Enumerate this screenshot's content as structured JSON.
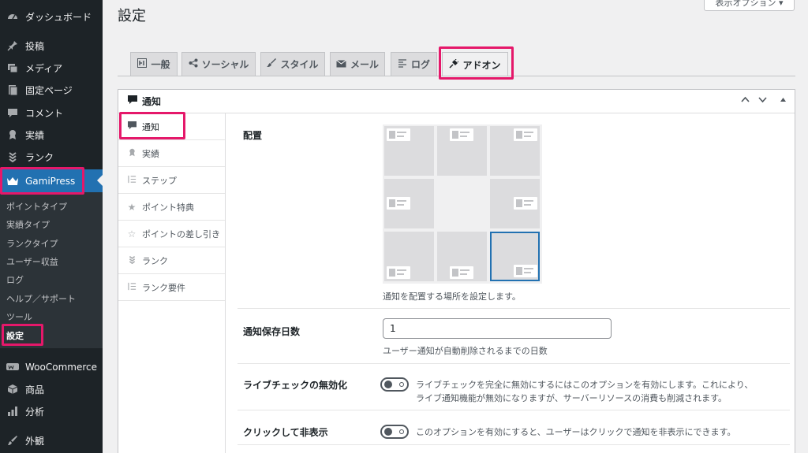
{
  "sidebar": {
    "items": [
      {
        "label": "ダッシュボード",
        "icon": "dashboard-icon"
      },
      {
        "label": "投稿",
        "icon": "pin-icon"
      },
      {
        "label": "メディア",
        "icon": "media-icon"
      },
      {
        "label": "固定ページ",
        "icon": "page-icon"
      },
      {
        "label": "コメント",
        "icon": "comment-icon"
      },
      {
        "label": "実績",
        "icon": "award-icon"
      },
      {
        "label": "ランク",
        "icon": "rank-icon"
      },
      {
        "label": "GamiPress",
        "icon": "crown-icon"
      },
      {
        "label": "WooCommerce",
        "icon": "woo-icon"
      },
      {
        "label": "商品",
        "icon": "box-icon"
      },
      {
        "label": "分析",
        "icon": "chart-icon"
      },
      {
        "label": "外観",
        "icon": "brush-icon"
      }
    ],
    "submenu": [
      "ポイントタイプ",
      "実績タイプ",
      "ランクタイプ",
      "ユーザー収益",
      "ログ",
      "ヘルプ／サポート",
      "ツール",
      "設定"
    ]
  },
  "header": {
    "title": "設定",
    "screen_options": "表示オプション ▾"
  },
  "tabs": [
    {
      "label": "一般",
      "icon": "general-icon"
    },
    {
      "label": "ソーシャル",
      "icon": "share-icon"
    },
    {
      "label": "スタイル",
      "icon": "brush-icon"
    },
    {
      "label": "メール",
      "icon": "mail-icon"
    },
    {
      "label": "ログ",
      "icon": "list-icon"
    },
    {
      "label": "アドオン",
      "icon": "plug-icon"
    }
  ],
  "panel": {
    "title": "通知",
    "nav": [
      "通知",
      "実績",
      "ステップ",
      "ポイント特典",
      "ポイントの差し引き",
      "ランク",
      "ランク要件"
    ]
  },
  "settings": {
    "position": {
      "label": "配置",
      "description": "通知を配置する場所を設定します。",
      "selected": "bottom-right"
    },
    "days": {
      "label": "通知保存日数",
      "value": "1",
      "description": "ユーザー通知が自動削除されるまでの日数"
    },
    "live_check": {
      "label": "ライブチェックの無効化",
      "description_line1": "ライブチェックを完全に無効にするにはこのオプションを有効にします。これにより、",
      "description_line2": "ライブ通知機能が無効になりますが、サーバーリソースの消費も削減されます。",
      "enabled": false
    },
    "click_hide": {
      "label": "クリックして非表示",
      "description": "このオプションを有効にすると、ユーザーはクリックで通知を非表示にできます。",
      "enabled": false
    }
  },
  "colors": {
    "accent": "#2271b1",
    "highlight": "#e5186a",
    "sidebar_bg": "#1d2327"
  }
}
